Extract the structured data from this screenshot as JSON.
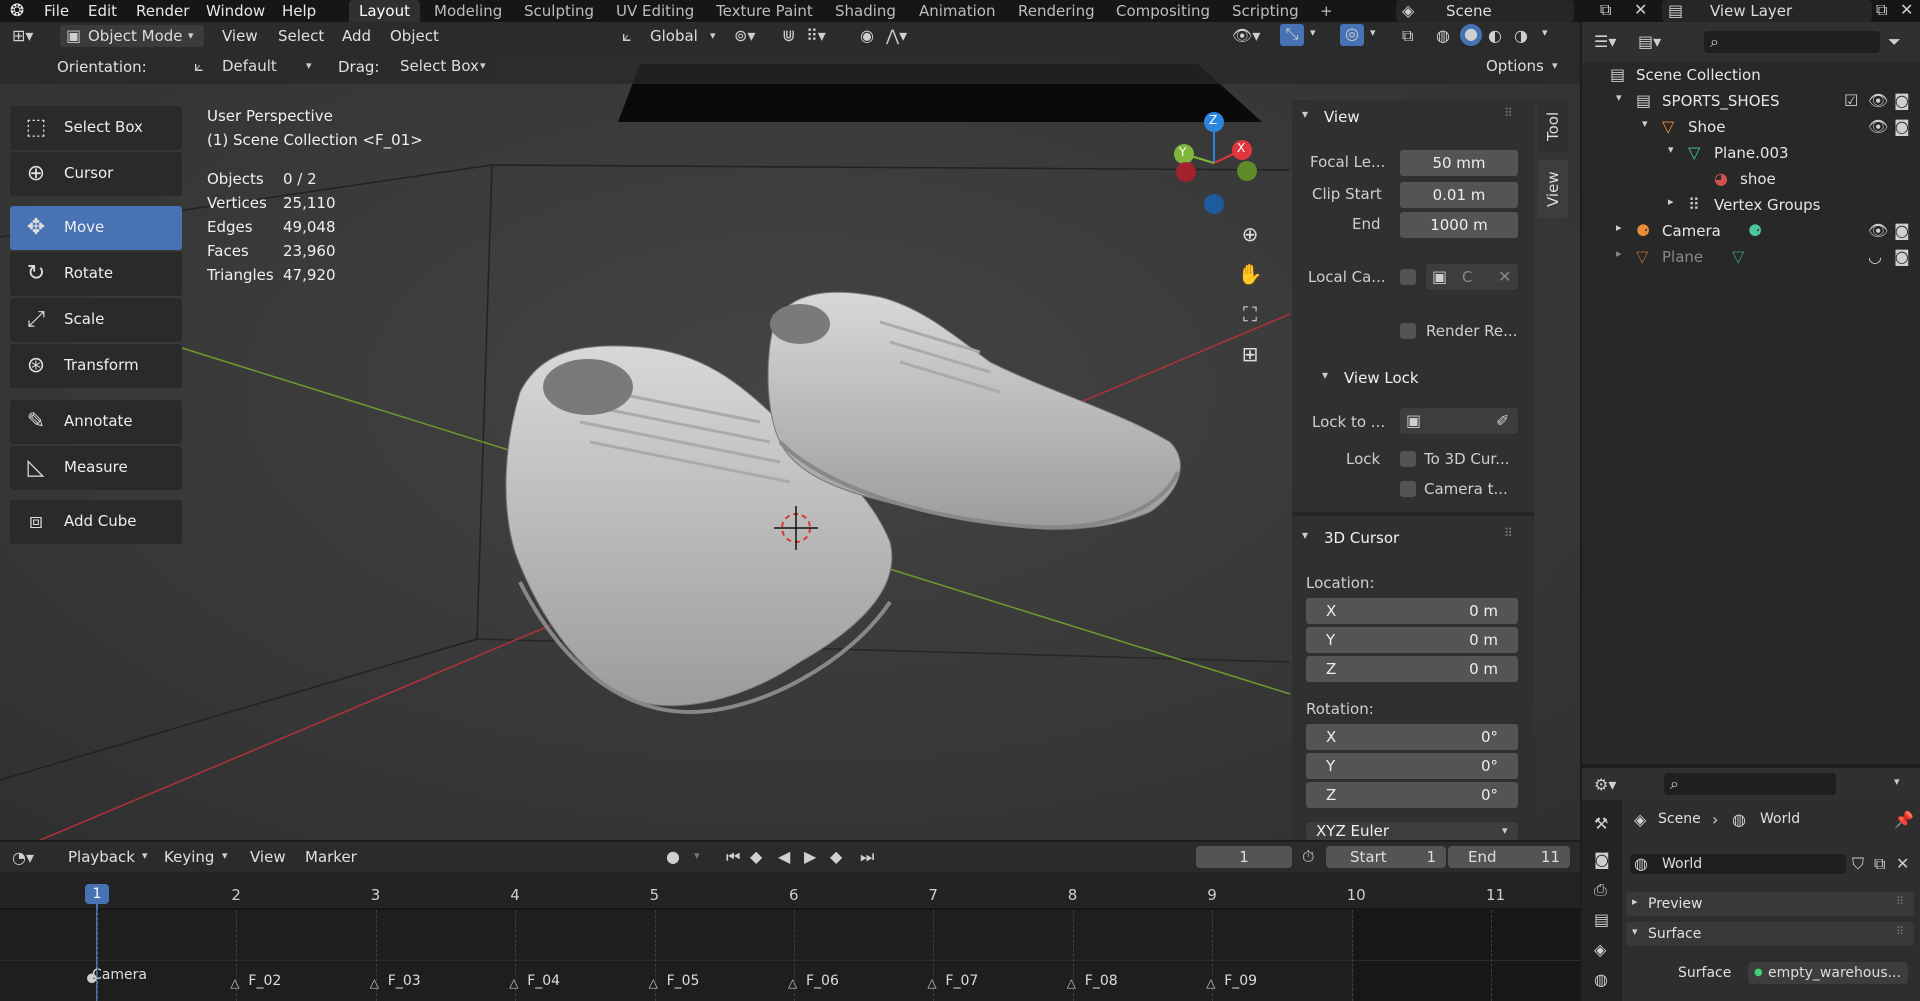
{
  "topbar": {
    "menus": [
      "File",
      "Edit",
      "Render",
      "Window",
      "Help"
    ],
    "workspaces": [
      "Layout",
      "Modeling",
      "Sculpting",
      "UV Editing",
      "Texture Paint",
      "Shading",
      "Animation",
      "Rendering",
      "Compositing",
      "Scripting"
    ],
    "add_tab": "+",
    "scene": "Scene",
    "view_layer": "View Layer"
  },
  "viewport": {
    "mode": "Object Mode",
    "menus": [
      "View",
      "Select",
      "Add",
      "Object"
    ],
    "transform_orientation": "Global",
    "orientation_label": "Orientation:",
    "orientation_value": "Default",
    "drag_label": "Drag:",
    "drag_value": "Select Box",
    "options": "Options",
    "perspective": "User Perspective",
    "collection": "(1) Scene Collection <F_01>",
    "stats": [
      {
        "label": "Objects",
        "value": "0 / 2"
      },
      {
        "label": "Vertices",
        "value": "25,110"
      },
      {
        "label": "Edges",
        "value": "49,048"
      },
      {
        "label": "Faces",
        "value": "23,960"
      },
      {
        "label": "Triangles",
        "value": "47,920"
      }
    ],
    "gizmo": {
      "x": "X",
      "y": "Y",
      "z": "Z"
    }
  },
  "toolbar": [
    {
      "label": "Select Box",
      "icon": "select-box-icon",
      "glyph": "⬚"
    },
    {
      "label": "Cursor",
      "icon": "cursor-icon",
      "glyph": "⊕"
    },
    {
      "label": "Move",
      "icon": "move-icon",
      "glyph": "✥"
    },
    {
      "label": "Rotate",
      "icon": "rotate-icon",
      "glyph": "↻"
    },
    {
      "label": "Scale",
      "icon": "scale-icon",
      "glyph": "⤢"
    },
    {
      "label": "Transform",
      "icon": "transform-icon",
      "glyph": "⊛"
    },
    {
      "label": "Annotate",
      "icon": "annotate-icon",
      "glyph": "✎"
    },
    {
      "label": "Measure",
      "icon": "measure-icon",
      "glyph": "◺"
    },
    {
      "label": "Add Cube",
      "icon": "add-cube-icon",
      "glyph": "⧈"
    }
  ],
  "npanel": {
    "tabs": [
      "Tool",
      "View"
    ],
    "view_header": "View",
    "focal_label": "Focal Le...",
    "focal_value": "50 mm",
    "clip_start_label": "Clip Start",
    "clip_start_value": "0.01 m",
    "end_label": "End",
    "end_value": "1000 m",
    "local_camera_label": "Local Ca...",
    "local_camera_value": "C",
    "render_region": "Render Re...",
    "view_lock_header": "View Lock",
    "lock_to_label": "Lock to ...",
    "lock_label": "Lock",
    "to_3d_cursor": "To 3D Cur...",
    "camera_to": "Camera t...",
    "cursor_header": "3D Cursor",
    "location_label": "Location:",
    "loc": [
      {
        "axis": "X",
        "value": "0 m"
      },
      {
        "axis": "Y",
        "value": "0 m"
      },
      {
        "axis": "Z",
        "value": "0 m"
      }
    ],
    "rotation_label": "Rotation:",
    "rot": [
      {
        "axis": "X",
        "value": "0°"
      },
      {
        "axis": "Y",
        "value": "0°"
      },
      {
        "axis": "Z",
        "value": "0°"
      }
    ],
    "rotation_mode": "XYZ Euler"
  },
  "outliner": {
    "rows": [
      {
        "label": "Scene Collection",
        "indent": 0
      },
      {
        "label": "SPORTS_SHOES",
        "indent": 1
      },
      {
        "label": "Shoe",
        "indent": 2
      },
      {
        "label": "Plane.003",
        "indent": 3
      },
      {
        "label": "shoe",
        "indent": 4
      },
      {
        "label": "Vertex Groups",
        "indent": 3
      },
      {
        "label": "Camera",
        "indent": 1
      },
      {
        "label": "Plane",
        "indent": 1
      }
    ]
  },
  "properties": {
    "breadcrumb_scene": "Scene",
    "breadcrumb_world": "World",
    "world_name": "World",
    "preview": "Preview",
    "surface_section": "Surface",
    "surface_label": "Surface",
    "surface_value": "empty_warehous..."
  },
  "timeline": {
    "menus": [
      "Playback",
      "Keying",
      "View",
      "Marker"
    ],
    "current_frame": "1",
    "start_label": "Start",
    "start_value": "1",
    "end_label": "End",
    "end_value": "11",
    "frames": [
      "1",
      "2",
      "3",
      "4",
      "5",
      "6",
      "7",
      "8",
      "9",
      "10",
      "11"
    ],
    "markers": [
      "F_02",
      "F_03",
      "F_04",
      "F_05",
      "F_06",
      "F_07",
      "F_08",
      "F_09"
    ],
    "camera_marker": "Camera"
  },
  "colors": {
    "accent": "#4772b3",
    "x_axis": "#e0363e",
    "y_axis": "#7fb53a",
    "z_axis": "#2a86df"
  }
}
